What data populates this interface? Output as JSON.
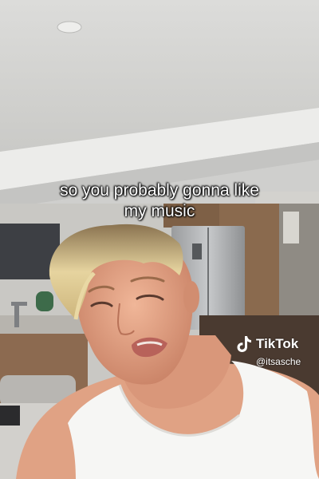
{
  "caption": {
    "line1": "so you probably gonna like",
    "line2": "my music"
  },
  "watermark": {
    "brand": "TikTok",
    "handle": "@itsasche",
    "icon": "tiktok-note-icon"
  },
  "colors": {
    "ceiling": "#d8d8d6",
    "cabinet_wood": "#8a6a4e",
    "hair_blonde": "#e2cf9a",
    "skin": "#e3a587",
    "tank_top": "#f6f6f4"
  }
}
